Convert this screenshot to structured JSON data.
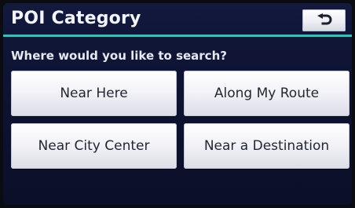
{
  "header": {
    "title": "POI Category",
    "back_icon": "return-arrow-icon"
  },
  "prompt": "Where would you like to search?",
  "options": [
    {
      "label": "Near Here"
    },
    {
      "label": "Along My Route"
    },
    {
      "label": "Near City Center"
    },
    {
      "label": "Near a Destination"
    }
  ],
  "colors": {
    "screen_bg": "#10163a",
    "accent_rule": "#4bb6b4",
    "button_face": "#f3f3f8",
    "button_text": "#222833",
    "title_text": "#f2f4f8"
  }
}
